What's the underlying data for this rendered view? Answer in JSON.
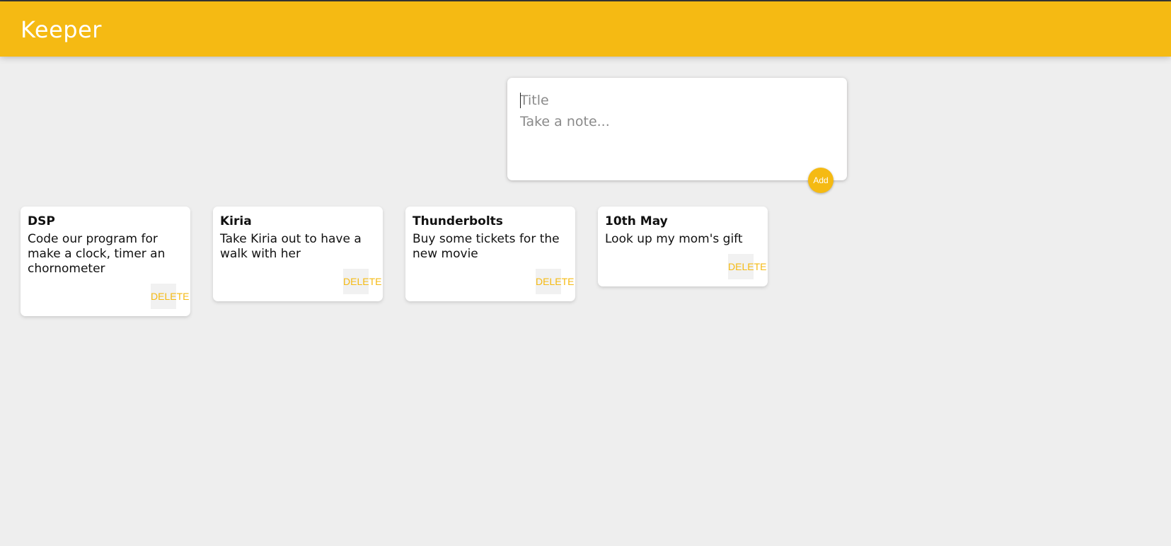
{
  "header": {
    "title": "Keeper"
  },
  "create_note": {
    "title_placeholder": "Title",
    "content_placeholder": "Take a note...",
    "add_label": "Add"
  },
  "notes": [
    {
      "title": "DSP",
      "content": "Code our program for make a clock, timer an chornometer",
      "delete_label": "DELETE"
    },
    {
      "title": "Kiria",
      "content": "Take Kiria out to have a walk with her",
      "delete_label": "DELETE"
    },
    {
      "title": "Thunderbolts",
      "content": "Buy some tickets for the new movie",
      "delete_label": "DELETE"
    },
    {
      "title": "10th May",
      "content": "Look up my mom's gift",
      "delete_label": "DELETE"
    }
  ],
  "colors": {
    "accent": "#f5ba13",
    "background": "#eeeeee"
  }
}
